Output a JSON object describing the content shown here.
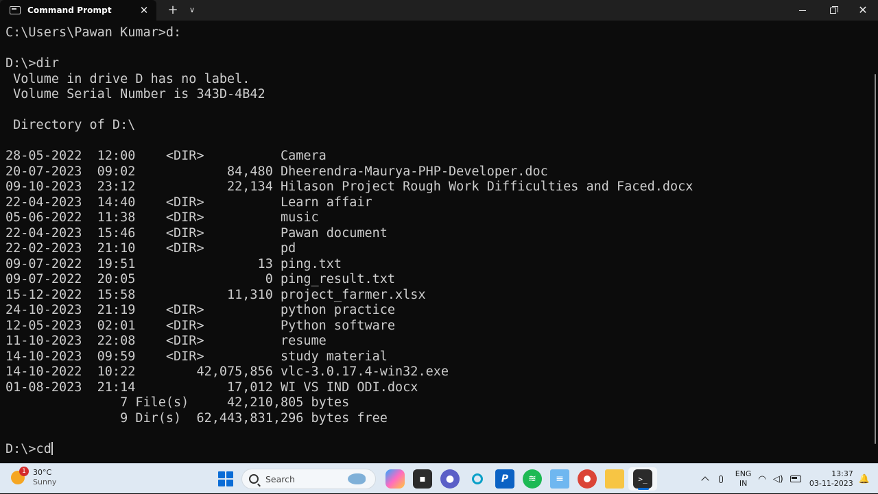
{
  "window": {
    "tab_title": "Command Prompt"
  },
  "terminal": {
    "lines": [
      "C:\\Users\\Pawan Kumar>d:",
      "",
      "D:\\>dir",
      " Volume in drive D has no label.",
      " Volume Serial Number is 343D-4B42",
      "",
      " Directory of D:\\",
      "",
      "28-05-2022  12:00    <DIR>          Camera",
      "20-07-2023  09:02            84,480 Dheerendra-Maurya-PHP-Developer.doc",
      "09-10-2023  23:12            22,134 Hilason Project Rough Work Difficulties and Faced.docx",
      "22-04-2023  14:40    <DIR>          Learn affair",
      "05-06-2022  11:38    <DIR>          music",
      "22-04-2023  15:46    <DIR>          Pawan document",
      "22-02-2023  21:10    <DIR>          pd",
      "09-07-2022  19:51                13 ping.txt",
      "09-07-2022  20:05                 0 ping_result.txt",
      "15-12-2022  15:58            11,310 project_farmer.xlsx",
      "24-10-2023  21:19    <DIR>          python practice",
      "12-05-2023  02:01    <DIR>          Python software",
      "11-10-2023  22:08    <DIR>          resume",
      "14-10-2023  09:59    <DIR>          study material",
      "14-10-2022  10:22        42,075,856 vlc-3.0.17.4-win32.exe",
      "01-08-2023  21:14            17,012 WI VS IND ODI.docx",
      "               7 File(s)     42,210,805 bytes",
      "               9 Dir(s)  62,443,831,296 bytes free",
      ""
    ],
    "prompt": "D:\\>cd"
  },
  "taskbar": {
    "weather_badge": "1",
    "temperature": "30°C",
    "condition": "Sunny",
    "search_label": "Search",
    "lang_top": "ENG",
    "lang_bottom": "IN",
    "time": "13:37",
    "date": "03-11-2023"
  },
  "colors": {
    "terminal_bg": "#0c0c0c",
    "terminal_fg": "#cccccc",
    "taskbar_bg": "#dfe9f3",
    "accent": "#0a6cd6"
  }
}
